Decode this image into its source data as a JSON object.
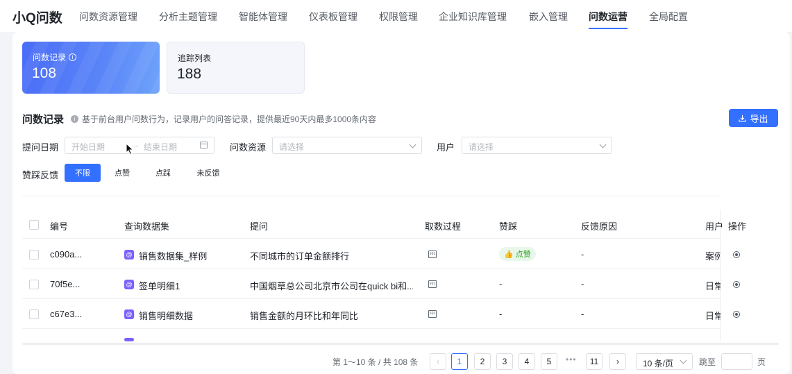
{
  "app": {
    "brand": "小Q问数"
  },
  "nav": [
    {
      "label": "问数资源管理",
      "active": false
    },
    {
      "label": "分析主题管理",
      "active": false
    },
    {
      "label": "智能体管理",
      "active": false
    },
    {
      "label": "仪表板管理",
      "active": false
    },
    {
      "label": "权限管理",
      "active": false
    },
    {
      "label": "企业知识库管理",
      "active": false
    },
    {
      "label": "嵌入管理",
      "active": false
    },
    {
      "label": "问数运营",
      "active": true
    },
    {
      "label": "全局配置",
      "active": false
    }
  ],
  "cards": [
    {
      "label": "问数记录",
      "value": "108",
      "active": true
    },
    {
      "label": "追踪列表",
      "value": "188",
      "active": false
    }
  ],
  "section": {
    "title": "问数记录",
    "desc": "基于前台用户问数行为，记录用户的问答记录，提供最近90天内最多1000条内容",
    "export": "导出"
  },
  "filters": {
    "date_label": "提问日期",
    "start_placeholder": "开始日期",
    "end_placeholder": "结束日期",
    "resource_label": "问数资源",
    "resource_placeholder": "请选择",
    "user_label": "用户",
    "user_placeholder": "请选择",
    "feedback_label": "赞踩反馈",
    "feedback_options": [
      {
        "label": "不限",
        "active": true
      },
      {
        "label": "点赞",
        "active": false
      },
      {
        "label": "点踩",
        "active": false
      },
      {
        "label": "未反馈",
        "active": false
      }
    ]
  },
  "table": {
    "headers": [
      "编号",
      "查询数据集",
      "提问",
      "取数过程",
      "赞踩",
      "反馈原因",
      "用户",
      "操作"
    ],
    "rows": [
      {
        "id": "c090a...",
        "dataset": "销售数据集_样例",
        "question": "不同城市的订单金额排行",
        "feedback": "点赞",
        "reason": "-",
        "user": "案例"
      },
      {
        "id": "70f5e...",
        "dataset": "签单明细1",
        "question": "中国烟草总公司北京市公司在quick bi和...",
        "feedback": "-",
        "reason": "-",
        "user": "日常"
      },
      {
        "id": "c67e3...",
        "dataset": "销售明细数据",
        "question": "销售金额的月环比和年同比",
        "feedback": "-",
        "reason": "-",
        "user": "日常"
      }
    ],
    "sql_icon_text": "SQL"
  },
  "pagination": {
    "summary": "第 1～10 条 / 共 108 条",
    "pages": [
      "1",
      "2",
      "3",
      "4",
      "5"
    ],
    "ellipsis": "•••",
    "last_page": "11",
    "current": "1",
    "page_size": "10 条/页",
    "jump_label": "跳至",
    "page_unit": "页"
  }
}
